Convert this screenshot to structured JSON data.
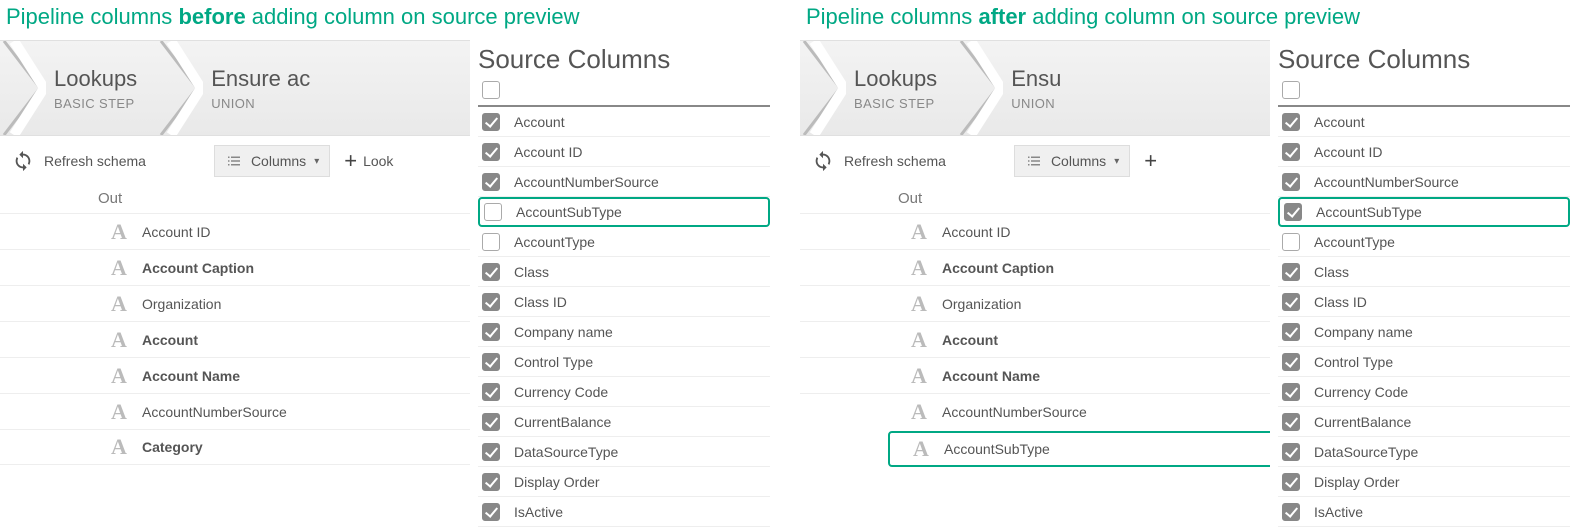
{
  "captions": {
    "before_prefix": "Pipeline columns ",
    "before_bold": "before",
    "before_suffix": " adding column on source preview",
    "after_prefix": "Pipeline columns ",
    "after_bold": "after",
    "after_suffix": " adding column on source preview"
  },
  "steps": {
    "lookups_title": "Lookups",
    "lookups_sub": "BASIC STEP",
    "ensure_title_before": "Ensure ac",
    "ensure_title_after": "Ensu",
    "union_sub": "UNION"
  },
  "toolbar": {
    "refresh": "Refresh schema",
    "columns": "Columns",
    "lookup_before": "Look",
    "plus_only": "+"
  },
  "out_label": "Out",
  "out_columns_before": [
    {
      "name": "Account ID",
      "bold": false
    },
    {
      "name": "Account Caption",
      "bold": true
    },
    {
      "name": "Organization",
      "bold": false
    },
    {
      "name": "Account",
      "bold": true
    },
    {
      "name": "Account Name",
      "bold": true
    },
    {
      "name": "AccountNumberSource",
      "bold": false
    },
    {
      "name": "Category",
      "bold": true
    }
  ],
  "out_columns_after": [
    {
      "name": "Account ID",
      "bold": false
    },
    {
      "name": "Account Caption",
      "bold": true
    },
    {
      "name": "Organization",
      "bold": false
    },
    {
      "name": "Account",
      "bold": true
    },
    {
      "name": "Account Name",
      "bold": true
    },
    {
      "name": "AccountNumberSource",
      "bold": false
    },
    {
      "name": "AccountSubType",
      "bold": false,
      "highlight": true
    }
  ],
  "src_title": "Source Columns",
  "src_columns_before": [
    {
      "name": "Account",
      "checked": true
    },
    {
      "name": "Account ID",
      "checked": true
    },
    {
      "name": "AccountNumberSource",
      "checked": true
    },
    {
      "name": "AccountSubType",
      "checked": false,
      "highlight": true
    },
    {
      "name": "AccountType",
      "checked": false
    },
    {
      "name": "Class",
      "checked": true
    },
    {
      "name": "Class ID",
      "checked": true
    },
    {
      "name": "Company name",
      "checked": true
    },
    {
      "name": "Control Type",
      "checked": true
    },
    {
      "name": "Currency Code",
      "checked": true
    },
    {
      "name": "CurrentBalance",
      "checked": true
    },
    {
      "name": "DataSourceType",
      "checked": true
    },
    {
      "name": "Display Order",
      "checked": true
    },
    {
      "name": "IsActive",
      "checked": true
    }
  ],
  "src_columns_after": [
    {
      "name": "Account",
      "checked": true
    },
    {
      "name": "Account ID",
      "checked": true
    },
    {
      "name": "AccountNumberSource",
      "checked": true
    },
    {
      "name": "AccountSubType",
      "checked": true,
      "highlight": true
    },
    {
      "name": "AccountType",
      "checked": false
    },
    {
      "name": "Class",
      "checked": true
    },
    {
      "name": "Class ID",
      "checked": true
    },
    {
      "name": "Company name",
      "checked": true
    },
    {
      "name": "Control Type",
      "checked": true
    },
    {
      "name": "Currency Code",
      "checked": true
    },
    {
      "name": "CurrentBalance",
      "checked": true
    },
    {
      "name": "DataSourceType",
      "checked": true
    },
    {
      "name": "Display Order",
      "checked": true
    },
    {
      "name": "IsActive",
      "checked": true
    }
  ]
}
